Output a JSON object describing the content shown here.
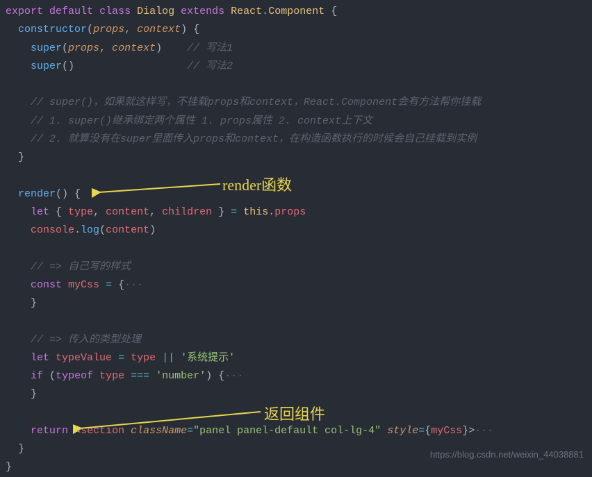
{
  "code": {
    "l1": {
      "export": "export",
      "default": "default",
      "class": "class",
      "dialog": "Dialog",
      "extends": "extends",
      "react": "React",
      "component": "Component"
    },
    "l2": {
      "constructor": "constructor",
      "props": "props",
      "context": "context"
    },
    "l3": {
      "super": "super",
      "props": "props",
      "context": "context",
      "comment": "// 写法1"
    },
    "l4": {
      "super": "super",
      "comment": "// 写法2"
    },
    "l6": {
      "comment": "// super()，如果就这样写，不挂载props和context，React.Component会有方法帮你挂载"
    },
    "l7": {
      "comment": "// 1. super()继承绑定两个属性 1. props属性 2. context上下文"
    },
    "l8": {
      "comment": "// 2. 就算没有在super里面传入props和context，在构造函数执行的时候会自己挂载到实例"
    },
    "l11": {
      "render": "render"
    },
    "l12": {
      "let": "let",
      "type": "type",
      "content": "content",
      "children": "children",
      "this": "this",
      "props": "props"
    },
    "l13": {
      "console": "console",
      "log": "log",
      "content": "content"
    },
    "l15": {
      "comment": "// => 自己写的样式"
    },
    "l16": {
      "const": "const",
      "mycss": "myCss"
    },
    "l19": {
      "comment": "// => 传入的类型处理"
    },
    "l20": {
      "let": "let",
      "typevalue": "typeValue",
      "type": "type",
      "string": "'系统提示'"
    },
    "l21": {
      "if": "if",
      "typeof": "typeof",
      "type": "type",
      "number": "'number'"
    },
    "l24": {
      "return": "return",
      "section": "section",
      "classname": "className",
      "classval": "\"panel panel-default col-lg-4\"",
      "style": "style",
      "mycss": "myCss"
    }
  },
  "annotations": {
    "render_fn": "render函数",
    "return_comp": "返回组件"
  },
  "watermark": "https://blog.csdn.net/weixin_44038881"
}
